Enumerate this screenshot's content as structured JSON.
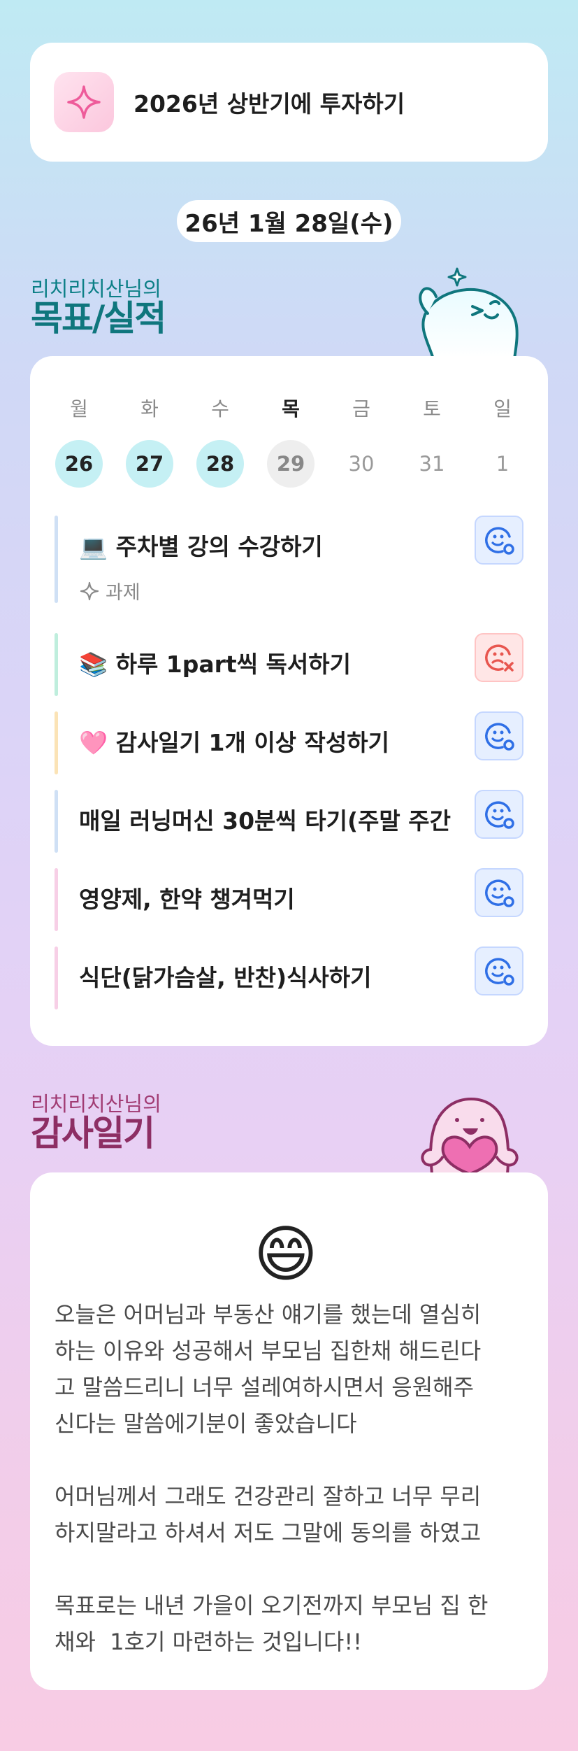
{
  "goal": {
    "title": "2026년 상반기에 투자하기",
    "icon": "sparkle-icon"
  },
  "date_label": "26년 1월 28일(수)",
  "plan_section": {
    "subtitle": "리치리치산님의",
    "title": "목표/실적"
  },
  "week": [
    {
      "day": "월",
      "date": "26",
      "state": "done"
    },
    {
      "day": "화",
      "date": "27",
      "state": "done"
    },
    {
      "day": "수",
      "date": "28",
      "state": "done"
    },
    {
      "day": "목",
      "date": "29",
      "state": "today"
    },
    {
      "day": "금",
      "date": "30",
      "state": "future"
    },
    {
      "day": "토",
      "date": "31",
      "state": "future"
    },
    {
      "day": "일",
      "date": "1",
      "state": "future"
    }
  ],
  "tasks": [
    {
      "title": "💻 주차별 강의 수강하기",
      "sub": "과제",
      "status": "ok",
      "bar_color": "#cfe0f5"
    },
    {
      "title": "📚 하루 1part씩 독서하기",
      "sub": "",
      "status": "fail",
      "bar_color": "#bfeedd"
    },
    {
      "title": "🩷 감사일기 1개 이상 작성하기",
      "sub": "",
      "status": "ok",
      "bar_color": "#fbe3b6"
    },
    {
      "title": "매일 러닝머신 30분씩 타기(주말 주간",
      "sub": "",
      "status": "ok",
      "bar_color": "#cfe0f5"
    },
    {
      "title": "영양제, 한약 챙겨먹기",
      "sub": "",
      "status": "ok",
      "bar_color": "#f7cfe6"
    },
    {
      "title": "식단(닭가슴살, 반찬)식사하기",
      "sub": "",
      "status": "ok",
      "bar_color": "#f7cfe6"
    }
  ],
  "diary_section": {
    "subtitle": "리치리치산님의",
    "title": "감사일기"
  },
  "diary": {
    "emoji": "😄",
    "text": "오늘은 어머님과 부동산 얘기를 했는데 열심히\n하는 이유와 성공해서 부모님 집한채 해드린다\n고 말씀드리니 너무 설레여하시면서 응원해주\n신다는 말씀에기분이 좋았습니다\n\n어머님께서 그래도 건강관리 잘하고 너무 무리\n하지말라고 하셔서 저도 그말에 동의를 하였고\n\n목표로는 내년 가을이 오기전까지 부모님 집 한\n채와  1호기 마련하는 것입니다!!"
  },
  "colors": {
    "teal": "#0f767d",
    "plum": "#8d2e64",
    "done_day": "#c5f0f4",
    "ok_blue": "#2f6fe6",
    "fail_red": "#e8564f"
  }
}
